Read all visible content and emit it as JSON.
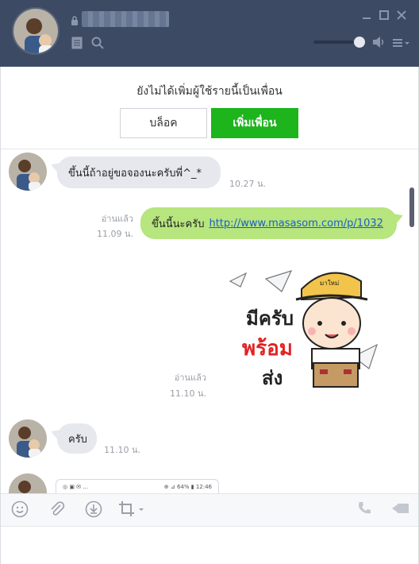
{
  "header": {
    "contact_name": "",
    "icons": {
      "lock": "lock-icon",
      "notes": "notes-icon",
      "search": "search-icon",
      "minimize": "minimize-icon",
      "maximize": "maximize-icon",
      "close": "close-icon",
      "volume": "speaker-icon",
      "menu": "menu-icon"
    },
    "volume_level": 0.88
  },
  "banner": {
    "text": "ยังไม่ได้เพิ่มผู้ใช้รายนี้เป็นเพื่อน",
    "block_label": "บล็อค",
    "add_friend_label": "เพิ่มเพื่อน"
  },
  "messages": [
    {
      "dir": "in",
      "text": "ขึ้นนี้ถ้าอยู่ขอจองนะครับพี่^_*",
      "time": "10.27 น."
    },
    {
      "dir": "out",
      "text": "ขึ้นนี้นะครับ",
      "link": "http://www.masasom.com/p/1032",
      "read": "อ่านแล้ว",
      "time": "11.09 น."
    },
    {
      "dir": "out",
      "type": "sticker",
      "sticker_text": [
        "มีครับ",
        "พร้อม",
        "ส่ง"
      ],
      "hat_text": "มาใหม่",
      "read": "อ่านแล้ว",
      "time": "11.10 น."
    },
    {
      "dir": "in",
      "text": "ครับ",
      "time": "11.10 น."
    },
    {
      "dir": "in",
      "type": "image",
      "status_left": "◎ ▣ ✉ ...",
      "status_right": "⊕ ⊿ 64% ▮ 12:46"
    }
  ],
  "toolbar": {
    "icons": [
      "smiley-icon",
      "attachment-icon",
      "download-icon",
      "crop-icon",
      "phone-icon",
      "video-icon"
    ]
  },
  "colors": {
    "header_bg": "#3d4a63",
    "add_friend": "#1db41c",
    "bubble_in": "#e6e8ee",
    "bubble_out": "#b7e57e"
  }
}
